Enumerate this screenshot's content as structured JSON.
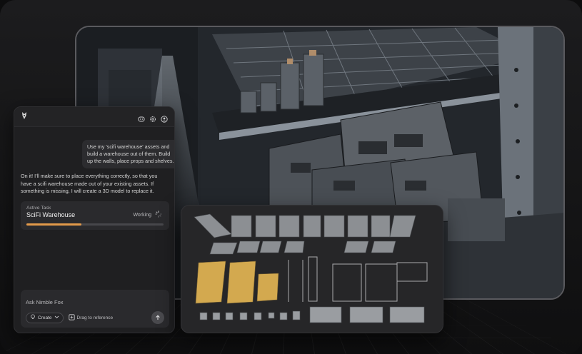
{
  "header": {
    "logo_icon": "fox-logo-icon",
    "icons": [
      "discord-icon",
      "settings-gear-icon",
      "user-profile-icon"
    ]
  },
  "chat": {
    "user_message": "Use my 'scifi warehouse' assets and build a warehouse out of them. Build up the walls, place props and shelves.",
    "assistant_message": "On it! I'll make sure to place everything correctly, so that you have a scifi warehouse made out of your existing assets. If something is missing, I will create a 3D model to replace it."
  },
  "active_task": {
    "label": "Active Task",
    "name": "SciFi Warehouse",
    "status": "Working",
    "progress": 0.4
  },
  "composer": {
    "placeholder": "Ask Nimble Fox",
    "create_label": "Create",
    "drag_label": "Drag to reference"
  },
  "colors": {
    "accent": "#e39a4a",
    "panel_bg": "#1f1f21",
    "page_bg": "#0d0d0e"
  }
}
